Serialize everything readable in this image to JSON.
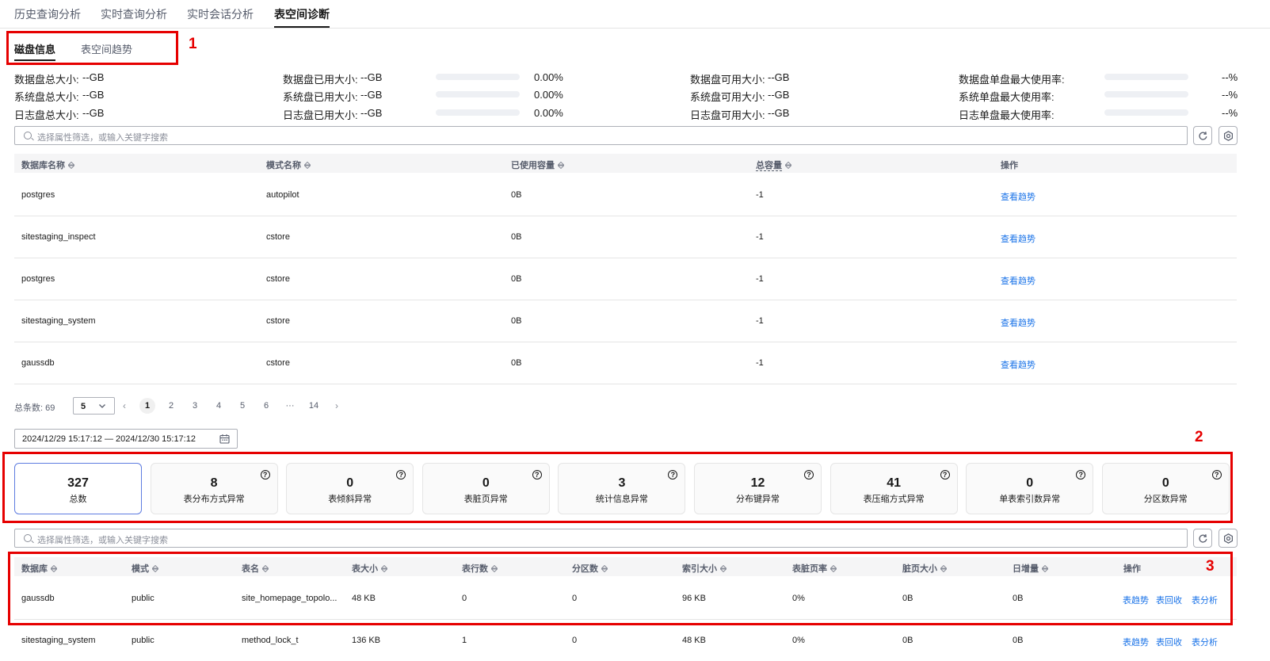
{
  "top_tabs": [
    "历史查询分析",
    "实时查询分析",
    "实时会话分析",
    "表空间诊断"
  ],
  "sub_tabs": [
    "磁盘信息",
    "表空间趋势"
  ],
  "annotations": [
    "1",
    "2",
    "3"
  ],
  "disk_stats": [
    {
      "total_label": "数据盘总大小:",
      "total_value": "--GB",
      "used_label": "数据盘已用大小:",
      "used_value": "--GB",
      "used_pct": "0.00%",
      "used_fraction": 0,
      "avail_label": "数据盘可用大小:",
      "avail_value": "--GB",
      "max_label": "数据盘单盘最大使用率:",
      "max_value": "--%"
    },
    {
      "total_label": "系统盘总大小:",
      "total_value": "--GB",
      "used_label": "系统盘已用大小:",
      "used_value": "--GB",
      "used_pct": "0.00%",
      "used_fraction": 0,
      "avail_label": "系统盘可用大小:",
      "avail_value": "--GB",
      "max_label": "系统单盘最大使用率:",
      "max_value": "--%"
    },
    {
      "total_label": "日志盘总大小:",
      "total_value": "--GB",
      "used_label": "日志盘已用大小:",
      "used_value": "--GB",
      "used_pct": "0.00%",
      "used_fraction": 0,
      "avail_label": "日志盘可用大小:",
      "avail_value": "--GB",
      "max_label": "日志单盘最大使用率:",
      "max_value": "--%"
    }
  ],
  "search1": {
    "placeholder": "选择属性筛选，或输入关键字搜索"
  },
  "table1": {
    "headers": [
      "数据库名称",
      "模式名称",
      "已使用容量",
      "总容量",
      "操作"
    ],
    "rows": [
      [
        "postgres",
        "autopilot",
        "0B",
        "-1",
        "查看趋势"
      ],
      [
        "sitestaging_inspect",
        "cstore",
        "0B",
        "-1",
        "查看趋势"
      ],
      [
        "postgres",
        "cstore",
        "0B",
        "-1",
        "查看趋势"
      ],
      [
        "sitestaging_system",
        "cstore",
        "0B",
        "-1",
        "查看趋势"
      ],
      [
        "gaussdb",
        "cstore",
        "0B",
        "-1",
        "查看趋势"
      ]
    ]
  },
  "pager": {
    "total_label": "总条数:",
    "total": "69",
    "page_size": "5",
    "pages": [
      "1",
      "2",
      "3",
      "4",
      "5",
      "6",
      "···",
      "14"
    ],
    "current": "1"
  },
  "date_range": "2024/12/29 15:17:12 — 2024/12/30 15:17:12",
  "cards": [
    {
      "num": "327",
      "label": "总数"
    },
    {
      "num": "8",
      "label": "表分布方式异常"
    },
    {
      "num": "0",
      "label": "表倾斜异常"
    },
    {
      "num": "0",
      "label": "表脏页异常"
    },
    {
      "num": "3",
      "label": "统计信息异常"
    },
    {
      "num": "12",
      "label": "分布键异常"
    },
    {
      "num": "41",
      "label": "表压缩方式异常"
    },
    {
      "num": "0",
      "label": "单表索引数异常"
    },
    {
      "num": "0",
      "label": "分区数异常"
    }
  ],
  "help_glyph": "?",
  "search2": {
    "placeholder": "选择属性筛选，或输入关键字搜索"
  },
  "table2": {
    "headers": [
      "数据库",
      "模式",
      "表名",
      "表大小",
      "表行数",
      "分区数",
      "索引大小",
      "表脏页率",
      "脏页大小",
      "日增量",
      "操作"
    ],
    "actions": [
      "表趋势",
      "表回收",
      "表分析"
    ],
    "rows": [
      [
        "gaussdb",
        "public",
        "site_homepage_topolo...",
        "48 KB",
        "0",
        "0",
        "96 KB",
        "0%",
        "0B",
        "0B"
      ],
      [
        "sitestaging_system",
        "public",
        "method_lock_t",
        "136 KB",
        "1",
        "0",
        "48 KB",
        "0%",
        "0B",
        "0B"
      ]
    ]
  },
  "colors": {
    "accent": "#5e7ce0",
    "link": "#1a73e8",
    "annotation": "#e60000"
  }
}
